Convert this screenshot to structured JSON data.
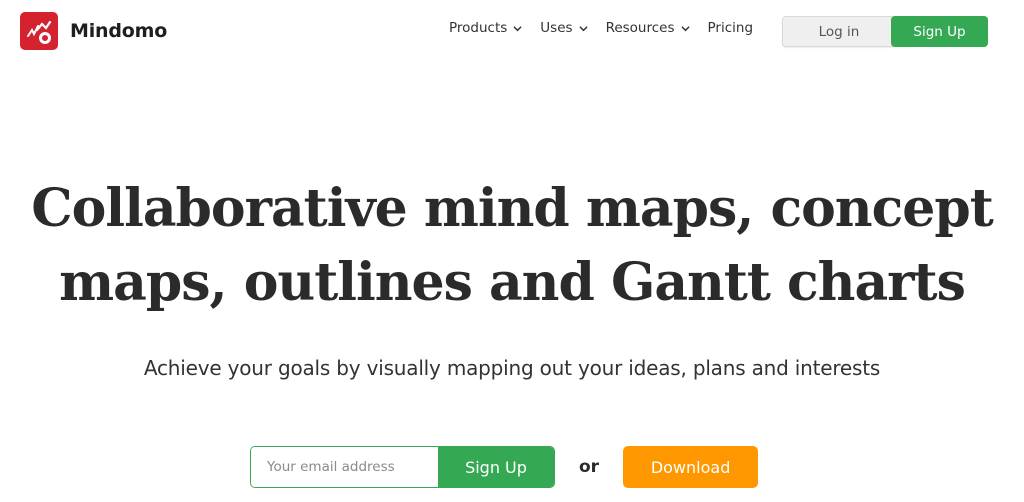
{
  "header": {
    "brand": "Mindomo",
    "logo_icon": "mindomo-logo-icon",
    "nav": [
      {
        "label": "Products",
        "has_dropdown": true
      },
      {
        "label": "Uses",
        "has_dropdown": true
      },
      {
        "label": "Resources",
        "has_dropdown": true
      },
      {
        "label": "Pricing",
        "has_dropdown": false
      }
    ],
    "login_label": "Log in",
    "signup_label": "Sign Up"
  },
  "hero": {
    "title_line1": "Collaborative mind maps, concept",
    "title_line2": "maps, outlines and Gantt charts",
    "subtitle": "Achieve your goals by visually mapping out your ideas, plans and interests"
  },
  "cta": {
    "email_placeholder": "Your email address",
    "email_value": "",
    "signup_label": "Sign Up",
    "or_label": "or",
    "download_label": "Download"
  },
  "colors": {
    "brand_red": "#d4222f",
    "green": "#34a853",
    "orange": "#ff9800"
  }
}
